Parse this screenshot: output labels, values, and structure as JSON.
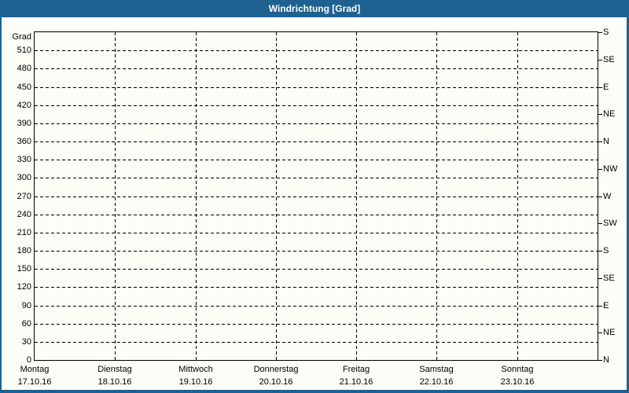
{
  "window": {
    "title": "Windrichtung [Grad]"
  },
  "colors": {
    "frame_blue": "#1E6191",
    "title_text": "#FFFFFF",
    "canvas_bg": "#FBFDF6",
    "grid": "#000000",
    "text": "#000000"
  },
  "chart_data": {
    "type": "line",
    "title": "Windrichtung [Grad]",
    "series": [],
    "note_no_data_plotted": true,
    "left_axis": {
      "label": "Grad",
      "min": 0,
      "max": 540,
      "tick_step": 30,
      "ticks": [
        0,
        30,
        60,
        90,
        120,
        150,
        180,
        210,
        240,
        270,
        300,
        330,
        360,
        390,
        420,
        450,
        480,
        510
      ]
    },
    "right_axis": {
      "tick_step": 45,
      "ticks": [
        {
          "deg": 0,
          "label": "N"
        },
        {
          "deg": 45,
          "label": "NE"
        },
        {
          "deg": 90,
          "label": "E"
        },
        {
          "deg": 135,
          "label": "SE"
        },
        {
          "deg": 180,
          "label": "S"
        },
        {
          "deg": 225,
          "label": "SW"
        },
        {
          "deg": 270,
          "label": "W"
        },
        {
          "deg": 315,
          "label": "NW"
        },
        {
          "deg": 360,
          "label": "N"
        },
        {
          "deg": 405,
          "label": "NE"
        },
        {
          "deg": 450,
          "label": "E"
        },
        {
          "deg": 495,
          "label": "SE"
        },
        {
          "deg": 540,
          "label": "S"
        }
      ]
    },
    "x_axis": {
      "categories": [
        {
          "day": "Montag",
          "date": "17.10.16"
        },
        {
          "day": "Dienstag",
          "date": "18.10.16"
        },
        {
          "day": "Mittwoch",
          "date": "19.10.16"
        },
        {
          "day": "Donnerstag",
          "date": "20.10.16"
        },
        {
          "day": "Freitag",
          "date": "21.10.16"
        },
        {
          "day": "Samstag",
          "date": "22.10.16"
        },
        {
          "day": "Sonntag",
          "date": "23.10.16"
        }
      ]
    },
    "grid": {
      "horizontal": "dashed",
      "vertical": "dashed"
    },
    "legend": "none"
  }
}
